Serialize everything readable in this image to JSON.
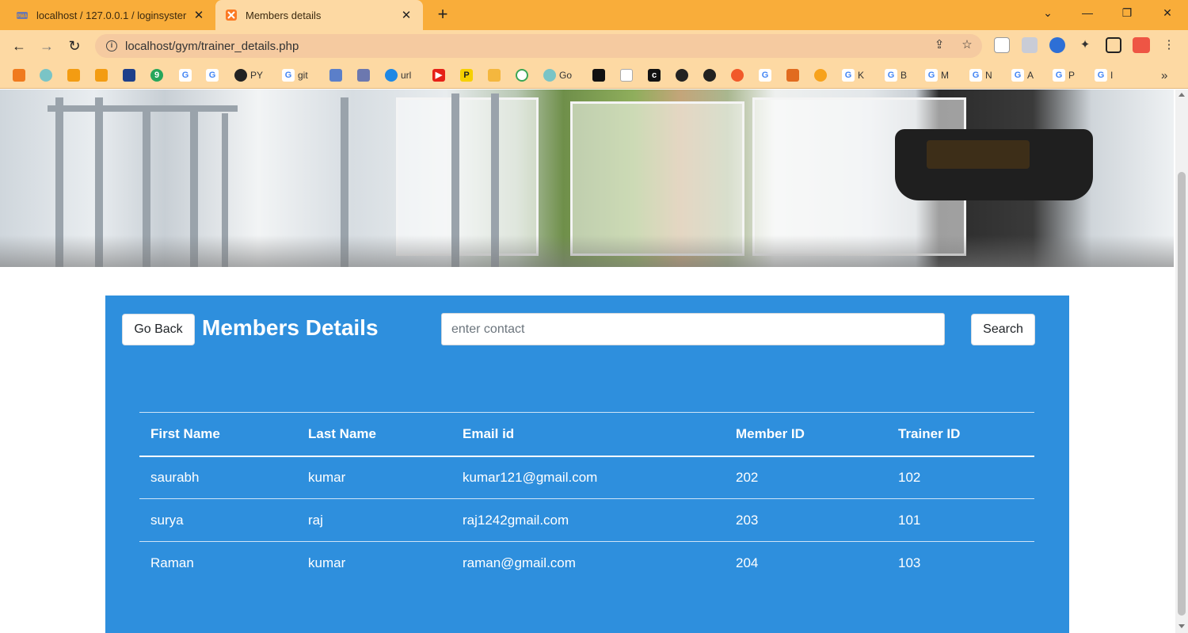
{
  "browser": {
    "tabs": [
      {
        "title": "localhost / 127.0.0.1 / loginsyster",
        "active": false,
        "favicon": "phpmyadmin-icon"
      },
      {
        "title": "Members details",
        "active": true,
        "favicon": "xampp-icon"
      }
    ],
    "new_tab": "+",
    "address": "localhost/gym/trainer_details.php",
    "bookmarks": [
      "PY",
      "git",
      "url",
      "Go",
      "K",
      "B",
      "M",
      "N",
      "A",
      "P",
      "I"
    ]
  },
  "page": {
    "go_back_label": "Go Back",
    "title": "Members Details",
    "search_placeholder": "enter contact",
    "search_label": "Search",
    "table": {
      "headers": [
        "First Name",
        "Last Name",
        "Email id",
        "Member ID",
        "Trainer ID"
      ],
      "rows": [
        [
          "saurabh",
          "kumar",
          "kumar121@gmail.com",
          "202",
          "102"
        ],
        [
          "surya",
          "raj",
          "raj1242gmail.com",
          "203",
          "101"
        ],
        [
          "Raman",
          "kumar",
          "raman@gmail.com",
          "204",
          "103"
        ]
      ]
    }
  },
  "colors": {
    "tabbar": "#f9ad3a",
    "toolbar": "#fdd9a3",
    "panel": "#2e8fdd"
  }
}
